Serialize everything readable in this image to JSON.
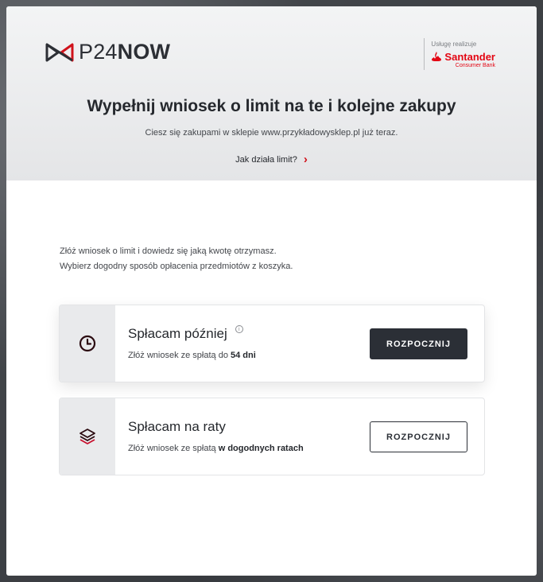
{
  "brand": {
    "logo_prefix": "P24",
    "logo_suffix": "NOW",
    "partner_caption": "Usługę realizuje",
    "partner_name": "Santander",
    "partner_sub": "Consumer Bank",
    "partner_color": "#e30613"
  },
  "header": {
    "title": "Wypełnij wniosek o limit na te i kolejne zakupy",
    "subtitle": "Ciesz się zakupami w sklepie www.przykładowysklep.pl już teraz.",
    "how_link": "Jak działa limit?"
  },
  "intro": {
    "line1": "Złóż wniosek o limit i dowiedz się jaką kwotę otrzymasz.",
    "line2": "Wybierz dogodny sposób opłacenia przedmiotów z koszyka."
  },
  "options": [
    {
      "icon": "clock-icon",
      "title": "Spłacam później",
      "desc_prefix": "Złóż wniosek ze spłatą do ",
      "desc_bold": "54 dni",
      "button": "ROZPOCZNIJ"
    },
    {
      "icon": "layers-icon",
      "title": "Spłacam na raty",
      "desc_prefix": "Złóż wniosek ze spłatą ",
      "desc_bold": "w dogodnych ratach",
      "button": "ROZPOCZNIJ"
    }
  ]
}
